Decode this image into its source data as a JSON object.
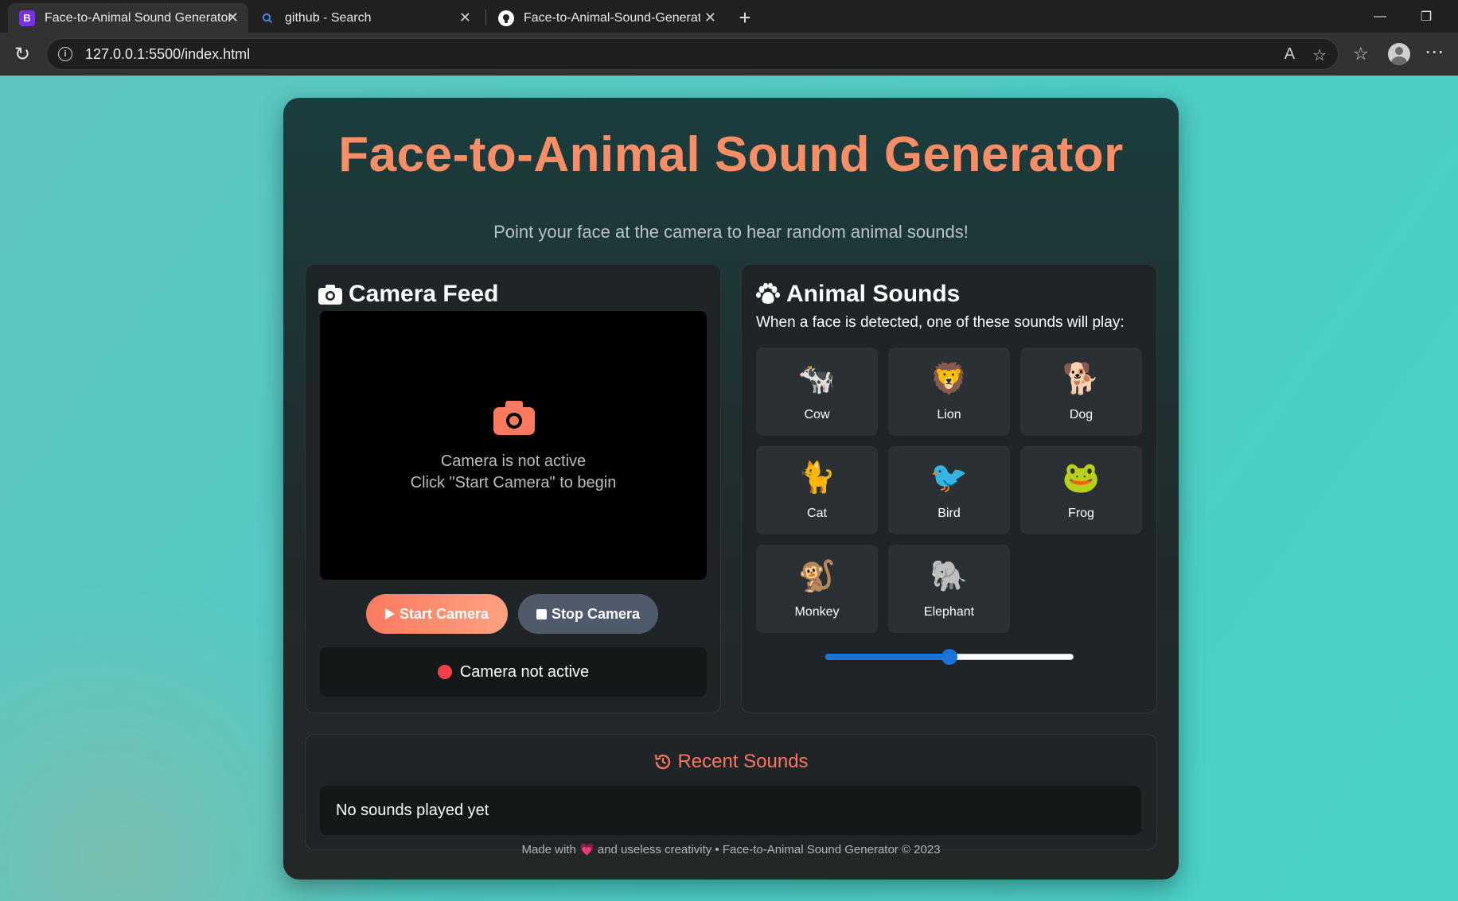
{
  "browser": {
    "tabs": [
      {
        "title": "Face-to-Animal Sound Generator",
        "icon": "B"
      },
      {
        "title": "github - Search",
        "icon": "search-icon"
      },
      {
        "title": "Face-to-Animal-Sound-Generator",
        "icon": "github-icon"
      }
    ],
    "url": "127.0.0.1:5500/index.html"
  },
  "page": {
    "title": "Face-to-Animal Sound Generator",
    "subtitle": "Point your face at the camera to hear random animal sounds!"
  },
  "camera": {
    "heading": "Camera Feed",
    "inactive_line1": "Camera is not active",
    "inactive_line2": "Click \"Start Camera\" to begin",
    "start_label": "Start Camera",
    "stop_label": "Stop Camera",
    "status_text": "Camera not active",
    "status_color": "#f1414e"
  },
  "sounds": {
    "heading": "Animal Sounds",
    "subtitle": "When a face is detected, one of these sounds will play:",
    "animals": [
      {
        "name": "Cow",
        "emoji": "🐄"
      },
      {
        "name": "Lion",
        "emoji": "🦁"
      },
      {
        "name": "Dog",
        "emoji": "🐕"
      },
      {
        "name": "Cat",
        "emoji": "🐈"
      },
      {
        "name": "Bird",
        "emoji": "🐦"
      },
      {
        "name": "Frog",
        "emoji": "🐸"
      },
      {
        "name": "Monkey",
        "emoji": "🐒"
      },
      {
        "name": "Elephant",
        "emoji": "🐘"
      }
    ],
    "volume_fraction": 0.5
  },
  "recent": {
    "heading": "Recent Sounds",
    "empty_text": "No sounds played yet"
  },
  "footer": {
    "prefix": "Made with",
    "heart": "💗",
    "suffix": "and useless creativity • Face-to-Animal Sound Generator © 2023"
  },
  "colors": {
    "accent": "#fb8d67",
    "start_button": "#fb7a5f",
    "stop_button": "#4f5a6b",
    "slider": "#1a73d9",
    "background": "#4dccc4"
  }
}
